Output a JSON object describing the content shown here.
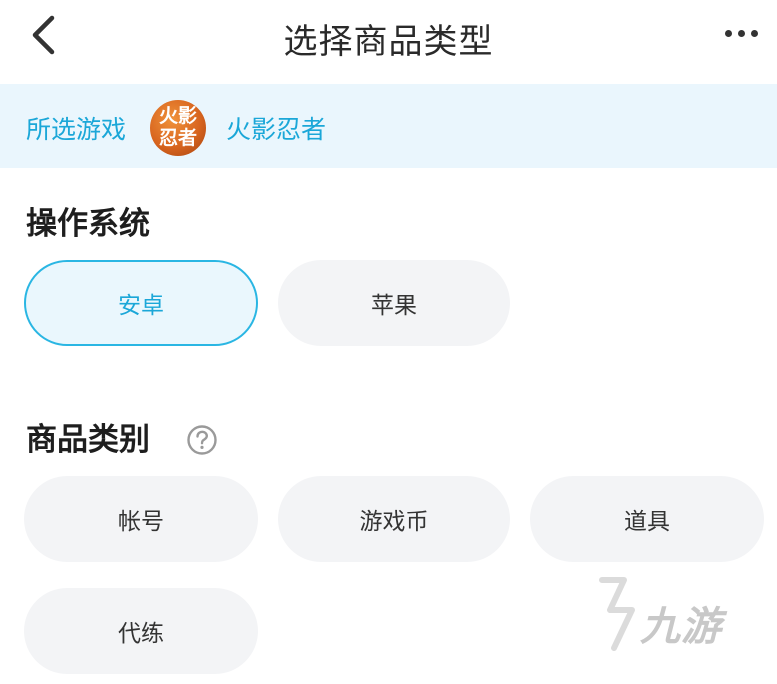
{
  "header": {
    "title": "选择商品类型",
    "back_icon": "chevron-left-icon",
    "more_icon": "more-horizontal-icon"
  },
  "game": {
    "label": "所选游戏",
    "logo_text_top": "火影",
    "logo_text_bottom": "忍者",
    "name": "火影忍者"
  },
  "os": {
    "title": "操作系统",
    "options": [
      {
        "label": "安卓",
        "selected": true
      },
      {
        "label": "苹果",
        "selected": false
      }
    ]
  },
  "category": {
    "title": "商品类别",
    "help_icon": "question-circle-icon",
    "options": [
      {
        "label": "帐号",
        "selected": false
      },
      {
        "label": "游戏币",
        "selected": false
      },
      {
        "label": "道具",
        "selected": false
      },
      {
        "label": "代练",
        "selected": false
      }
    ]
  },
  "watermark": {
    "text": "九游"
  },
  "colors": {
    "accent": "#1ba7d8",
    "game_bar_bg": "#eaf6fd",
    "chip_bg": "#f3f4f6"
  }
}
